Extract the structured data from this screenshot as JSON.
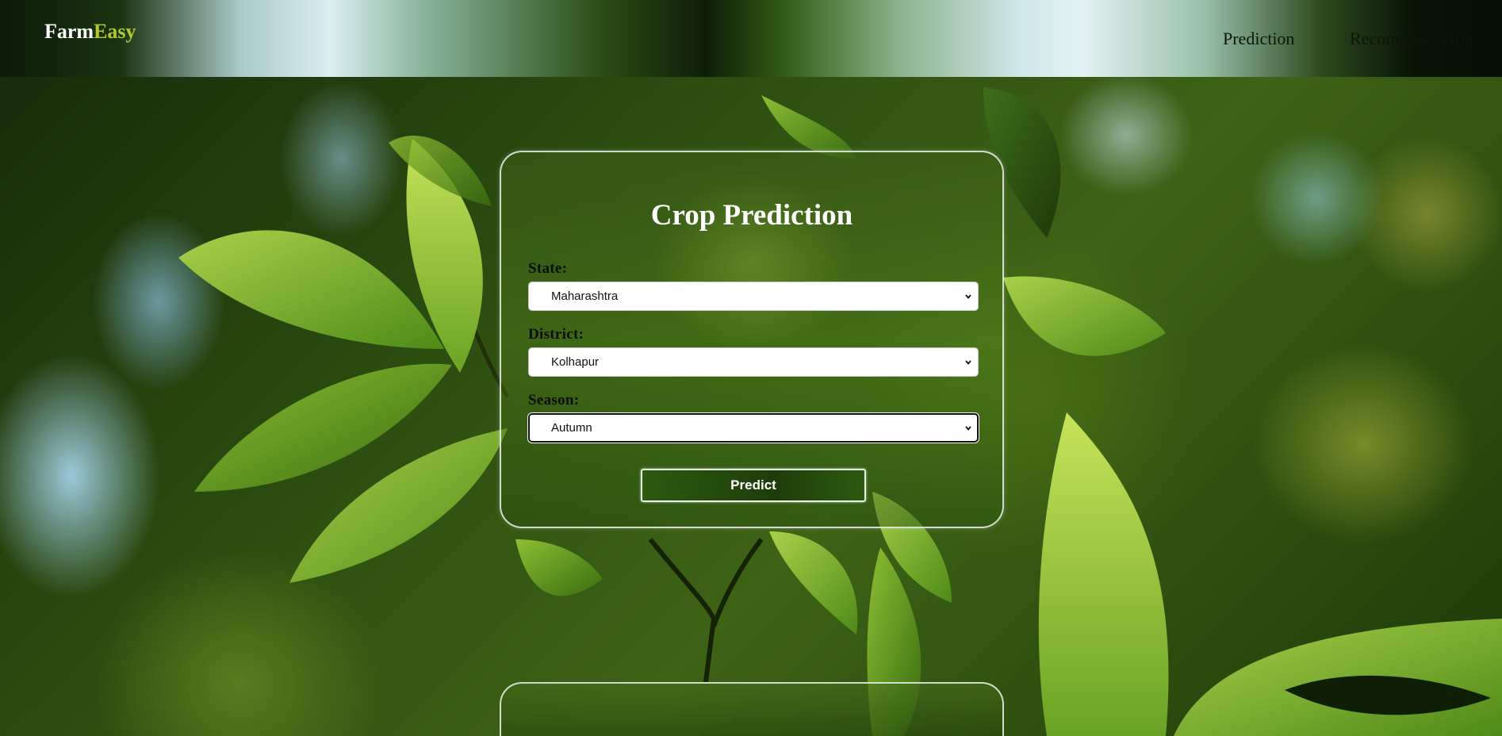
{
  "header": {
    "logo_part1": "Farm",
    "logo_part2": "Easy",
    "nav": {
      "prediction": "Prediction",
      "recommendation": "Recommendation"
    }
  },
  "form": {
    "title": "Crop Prediction",
    "state": {
      "label": "State:",
      "value": "Maharashtra"
    },
    "district": {
      "label": "District:",
      "value": "Kolhapur"
    },
    "season": {
      "label": "Season:",
      "value": "Autumn"
    },
    "submit_label": "Predict"
  },
  "colors": {
    "logo_primary": "#ffffff",
    "logo_accent": "#b4c82e",
    "button_bg": "#1c3d0a"
  },
  "icons": {
    "select_caret": "chevron-down-icon"
  }
}
